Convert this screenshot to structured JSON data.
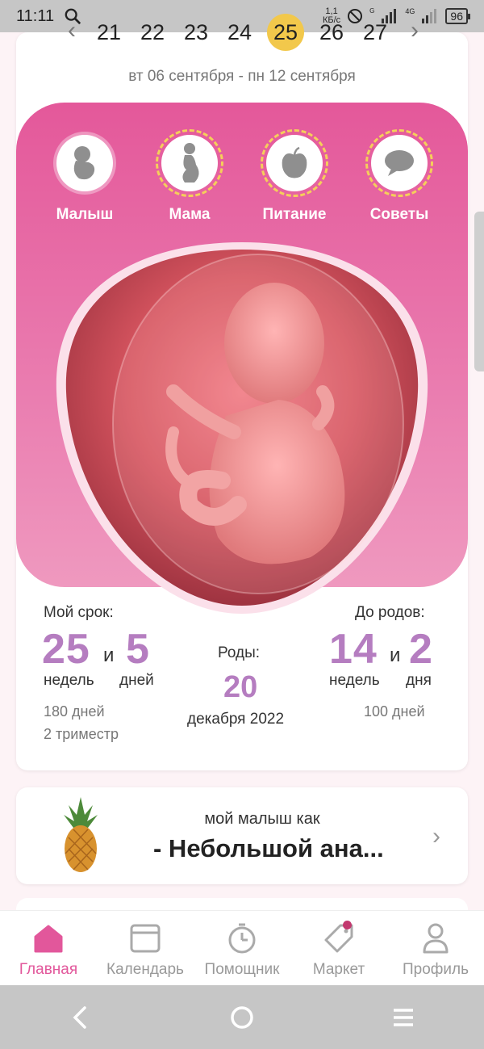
{
  "status_bar": {
    "time": "11:11",
    "speed_value": "1,1",
    "speed_unit": "КБ/с",
    "network": "4G",
    "network_small": "G",
    "battery": "96"
  },
  "week": {
    "days": [
      "21",
      "22",
      "23",
      "24",
      "25",
      "26",
      "27"
    ],
    "selected": "25",
    "date_range": "вт 06 сентября - пн 12 сентября"
  },
  "categories": [
    {
      "label": "Малыш",
      "icon": "baby-icon"
    },
    {
      "label": "Мама",
      "icon": "pregnant-mother-icon"
    },
    {
      "label": "Питание",
      "icon": "apple-icon"
    },
    {
      "label": "Советы",
      "icon": "speech-bubble-icon"
    }
  ],
  "stats": {
    "term_label": "Мой срок:",
    "term_weeks": "25",
    "term_and": "и",
    "term_days": "5",
    "term_weeks_unit": "недель",
    "term_days_unit": "дней",
    "term_total_days": "180 дней",
    "trimester": "2 триместр",
    "birth_label": "Роды:",
    "birth_day": "20",
    "birth_month_year": "декабря 2022",
    "left_label": "До родов:",
    "left_weeks": "14",
    "left_and": "и",
    "left_days": "2",
    "left_weeks_unit": "недель",
    "left_days_unit": "дня",
    "left_total_days": "100 дней"
  },
  "compare": {
    "intro": "мой малыш как",
    "title": "- Небольшой ана...",
    "fruit_icon": "pineapple-icon"
  },
  "bottom_nav": [
    {
      "label": "Главная",
      "icon": "home-icon",
      "active": true
    },
    {
      "label": "Календарь",
      "icon": "calendar-icon",
      "active": false
    },
    {
      "label": "Помощник",
      "icon": "timer-icon",
      "active": false
    },
    {
      "label": "Маркет",
      "icon": "tag-icon",
      "active": false
    },
    {
      "label": "Профиль",
      "icon": "profile-icon",
      "active": false
    }
  ],
  "colors": {
    "accent": "#e2579b",
    "number": "#b57dc0",
    "selected_day": "#f2c84b"
  }
}
